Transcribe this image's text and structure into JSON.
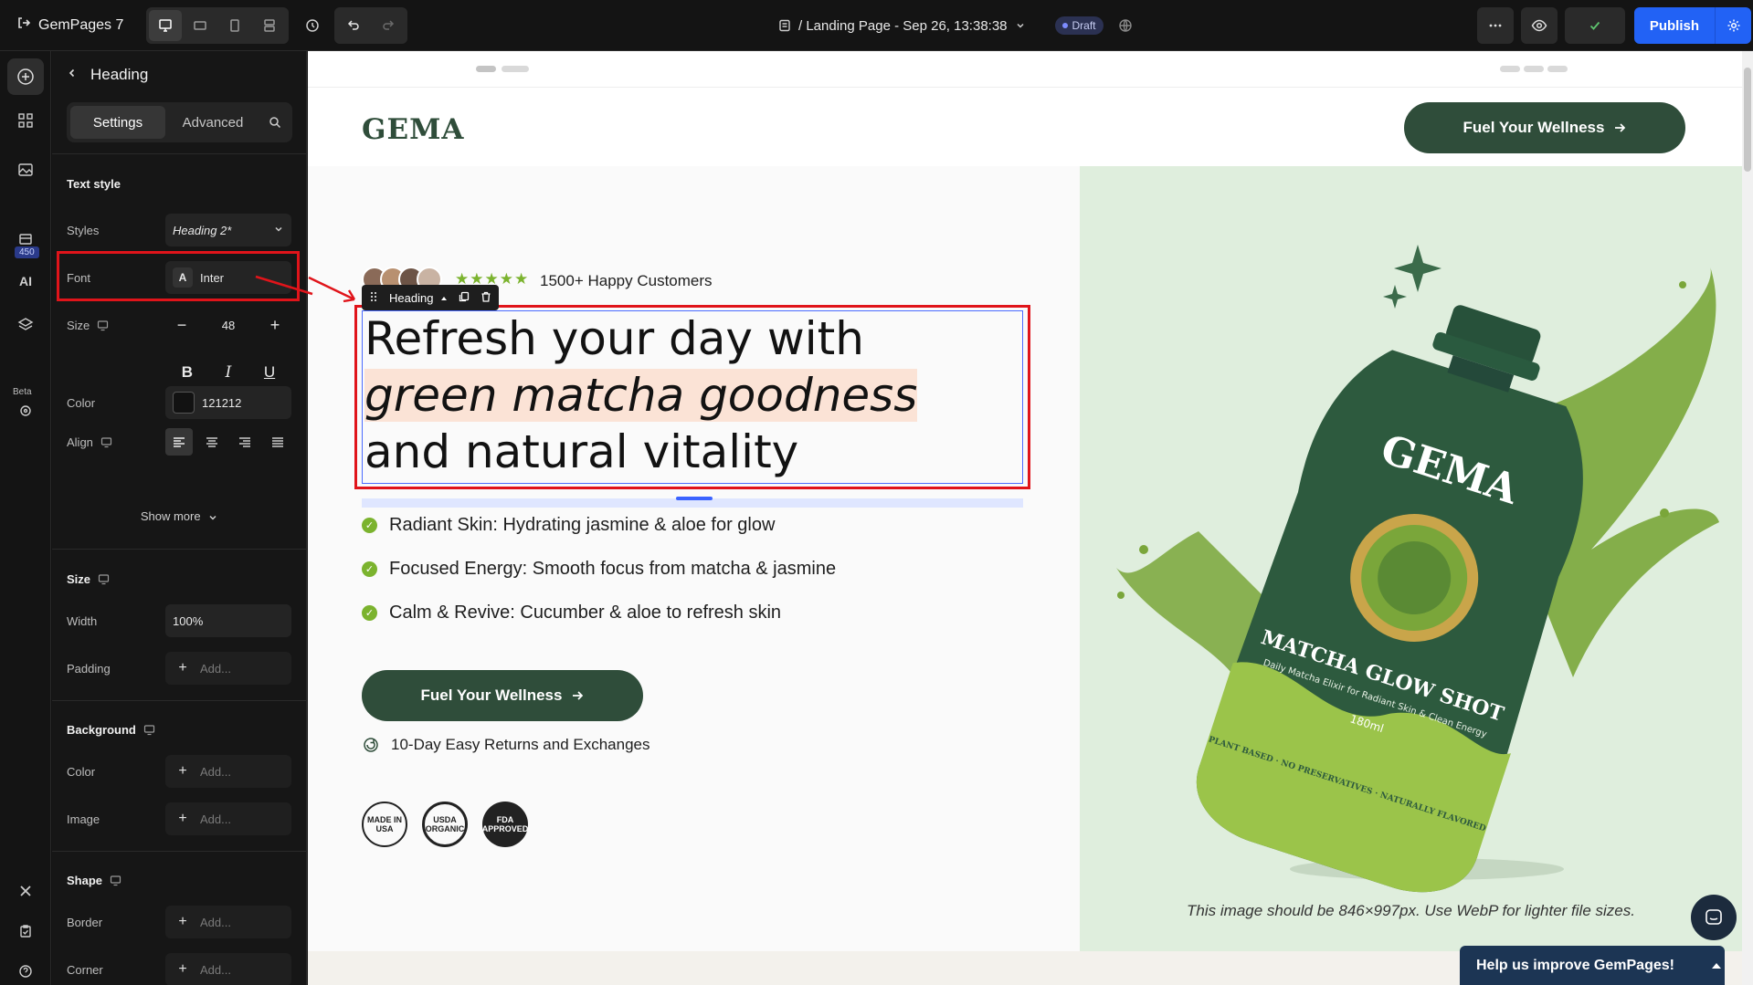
{
  "app": {
    "brand": "GemPages 7",
    "page_title": "/ Landing Page - Sep 26, 13:38:38",
    "status": "Draft",
    "publish_label": "Publish"
  },
  "rail": {
    "badge": "450",
    "beta": "Beta",
    "ai": "AI"
  },
  "panel": {
    "title": "Heading",
    "tabs": [
      "Settings",
      "Advanced"
    ],
    "text_style": {
      "title": "Text style",
      "styles_label": "Styles",
      "styles_value": "Heading 2*",
      "font_label": "Font",
      "font_value": "Inter",
      "size_label": "Size",
      "size_value": "48",
      "color_label": "Color",
      "color_value": "121212",
      "align_label": "Align",
      "show_more": "Show more"
    },
    "size_section": {
      "title": "Size",
      "width_label": "Width",
      "width_value": "100%",
      "padding_label": "Padding",
      "padding_value": "Add..."
    },
    "background_section": {
      "title": "Background",
      "color_label": "Color",
      "color_value": "Add...",
      "image_label": "Image",
      "image_value": "Add..."
    },
    "shape_section": {
      "title": "Shape",
      "border_label": "Border",
      "border_value": "Add...",
      "corner_label": "Corner",
      "corner_value": "Add..."
    }
  },
  "canvas": {
    "logo": "GEMA",
    "header_cta": "Fuel Your Wellness",
    "stars": "★★★★★",
    "happy_customers": "1500+ Happy Customers",
    "toolbar_label": "Heading",
    "heading_line1": "Refresh your day with",
    "heading_line2": "green matcha goodness",
    "heading_line3": "and natural vitality",
    "bullets": [
      "Radiant Skin: Hydrating jasmine & aloe for glow",
      "Focused Energy: Smooth focus from matcha & jasmine",
      "Calm & Revive: Cucumber & aloe to refresh skin"
    ],
    "main_cta": "Fuel Your Wellness",
    "returns": "10-Day Easy Returns and Exchanges",
    "badges": [
      "MADE IN USA",
      "USDA ORGANIC",
      "FDA APPROVED"
    ],
    "pouch": {
      "brand": "GEMA",
      "product": "MATCHA GLOW SHOT",
      "tagline": "Daily Matcha Elixir for Radiant Skin & Clean Energy",
      "volume": "180ml",
      "footer": "PLANT BASED · NO PRESERVATIVES · NATURALLY FLAVORED"
    },
    "image_note": "This image should be 846×997px. Use WebP for lighter file sizes.",
    "help_bar": "Help us improve GemPages!"
  },
  "colors": {
    "accent": "#2262f5",
    "brand_green": "#2f4d3a",
    "star_green": "#7bb32e",
    "highlight": "#fbe3d6",
    "selection": "#e0141a"
  }
}
